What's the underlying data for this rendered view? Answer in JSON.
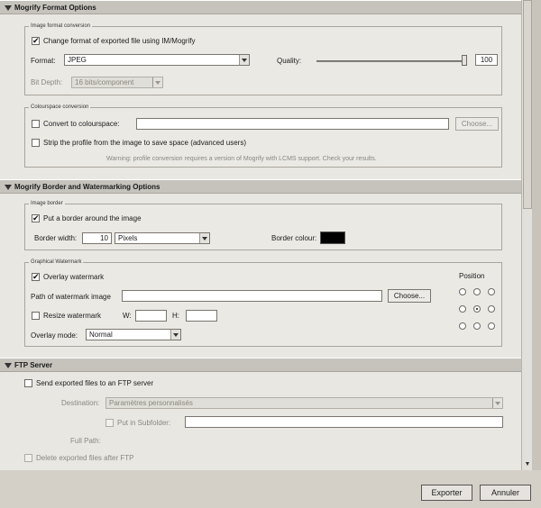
{
  "sections": {
    "mogrify_format": {
      "title": "Mogrify Format Options",
      "image_format_group": {
        "title": "Image format conversion",
        "change_format_label": "Change format of exported file using IM/Mogrify",
        "change_format_checked": true,
        "format_label": "Format:",
        "format_value": "JPEG",
        "quality_label": "Quality:",
        "quality_value": "100",
        "bit_depth_label": "Bit Depth:",
        "bit_depth_value": "16 bits/component"
      },
      "colourspace_group": {
        "title": "Colourspace conversion",
        "convert_label": "Convert to colourspace:",
        "convert_checked": false,
        "choose_label": "Choose...",
        "strip_label": "Strip the profile from the image to save space (advanced users)",
        "strip_checked": false,
        "warning_text": "Warning: profile conversion requires a version of Mogrify with LCMS support. Check your results."
      }
    },
    "border_watermark": {
      "title": "Mogrify Border and Watermarking Options",
      "image_border_group": {
        "title": "Image border",
        "put_border_label": "Put a border around the image",
        "put_border_checked": true,
        "border_width_label": "Border width:",
        "border_width_value": "10",
        "border_unit_value": "Pixels",
        "border_colour_label": "Border colour:",
        "border_colour": "#000000"
      },
      "watermark_group": {
        "title": "Graphical Watermark",
        "overlay_label": "Overlay watermark",
        "overlay_checked": true,
        "path_label": "Path of watermark image",
        "path_value": "",
        "choose_label": "Choose...",
        "resize_label": "Resize watermark",
        "resize_checked": false,
        "w_label": "W:",
        "h_label": "H:",
        "overlay_mode_label": "Overlay mode:",
        "overlay_mode_value": "Normal",
        "position_label": "Position",
        "position_selected": "center"
      }
    },
    "ftp": {
      "title": "FTP Server",
      "send_label": "Send exported files to an FTP server",
      "send_checked": false,
      "destination_label": "Destination:",
      "destination_value": "Paramètres personnalisés",
      "put_in_subfolder_label": "Put in Subfolder:",
      "subfolder_value": "",
      "full_path_label": "Full Path:",
      "delete_label": "Delete exported files after FTP"
    }
  },
  "footer": {
    "export_label": "Exporter",
    "cancel_label": "Annuler"
  },
  "icons": {
    "section_toggle": "triangle-down-icon",
    "scroll_down": "arrow-down-icon"
  }
}
